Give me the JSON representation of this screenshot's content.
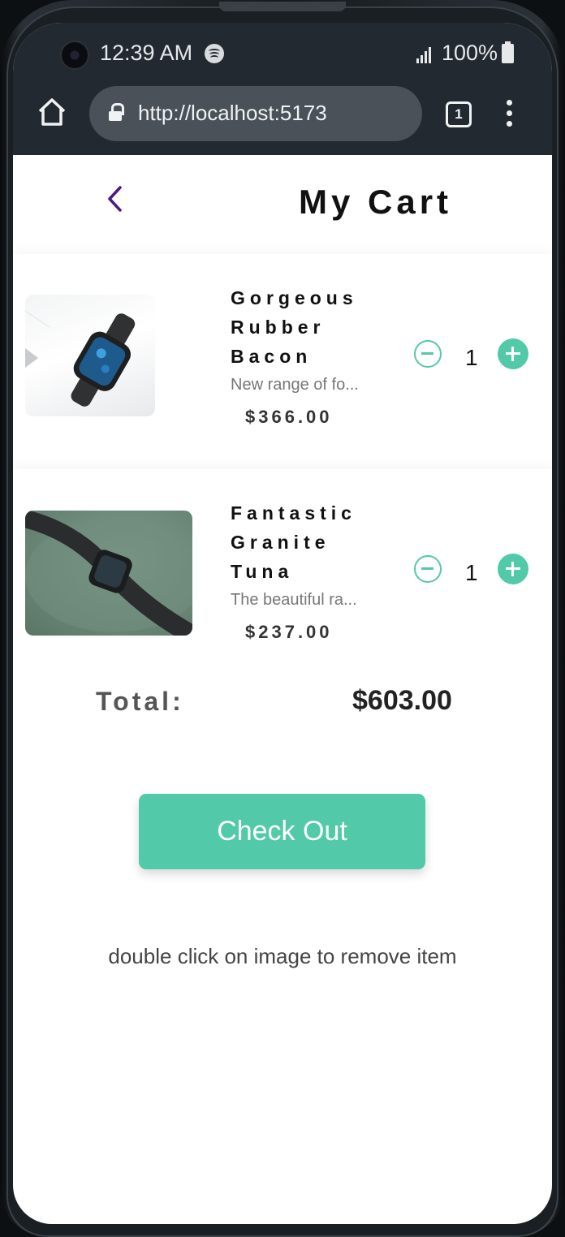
{
  "status_bar": {
    "time": "12:39 AM",
    "battery": "100%",
    "icons": [
      "camera-icon",
      "spotify-icon",
      "signal-icon",
      "battery-icon"
    ]
  },
  "browser": {
    "url": "http://localhost:5173",
    "tab_count": "1",
    "icons": [
      "home-icon",
      "lock-icon",
      "tabs-icon",
      "more-vert-icon"
    ]
  },
  "header": {
    "title": "My Cart",
    "back_icon": "chevron-left-icon"
  },
  "cart": {
    "items": [
      {
        "name": "Gorgeous Rubber Bacon",
        "description": "New range of fo...",
        "price": "$366.00",
        "quantity": "1"
      },
      {
        "name": "Fantastic Granite Tuna",
        "description": "The beautiful ra...",
        "price": "$237.00",
        "quantity": "1"
      }
    ],
    "total_label": "Total:",
    "total_value": "$603.00",
    "checkout_label": "Check Out",
    "hint": "double click on image to remove item"
  },
  "colors": {
    "accent": "#52c9a8",
    "back_arrow": "#4b1a7f",
    "browser_chrome": "#232930"
  }
}
